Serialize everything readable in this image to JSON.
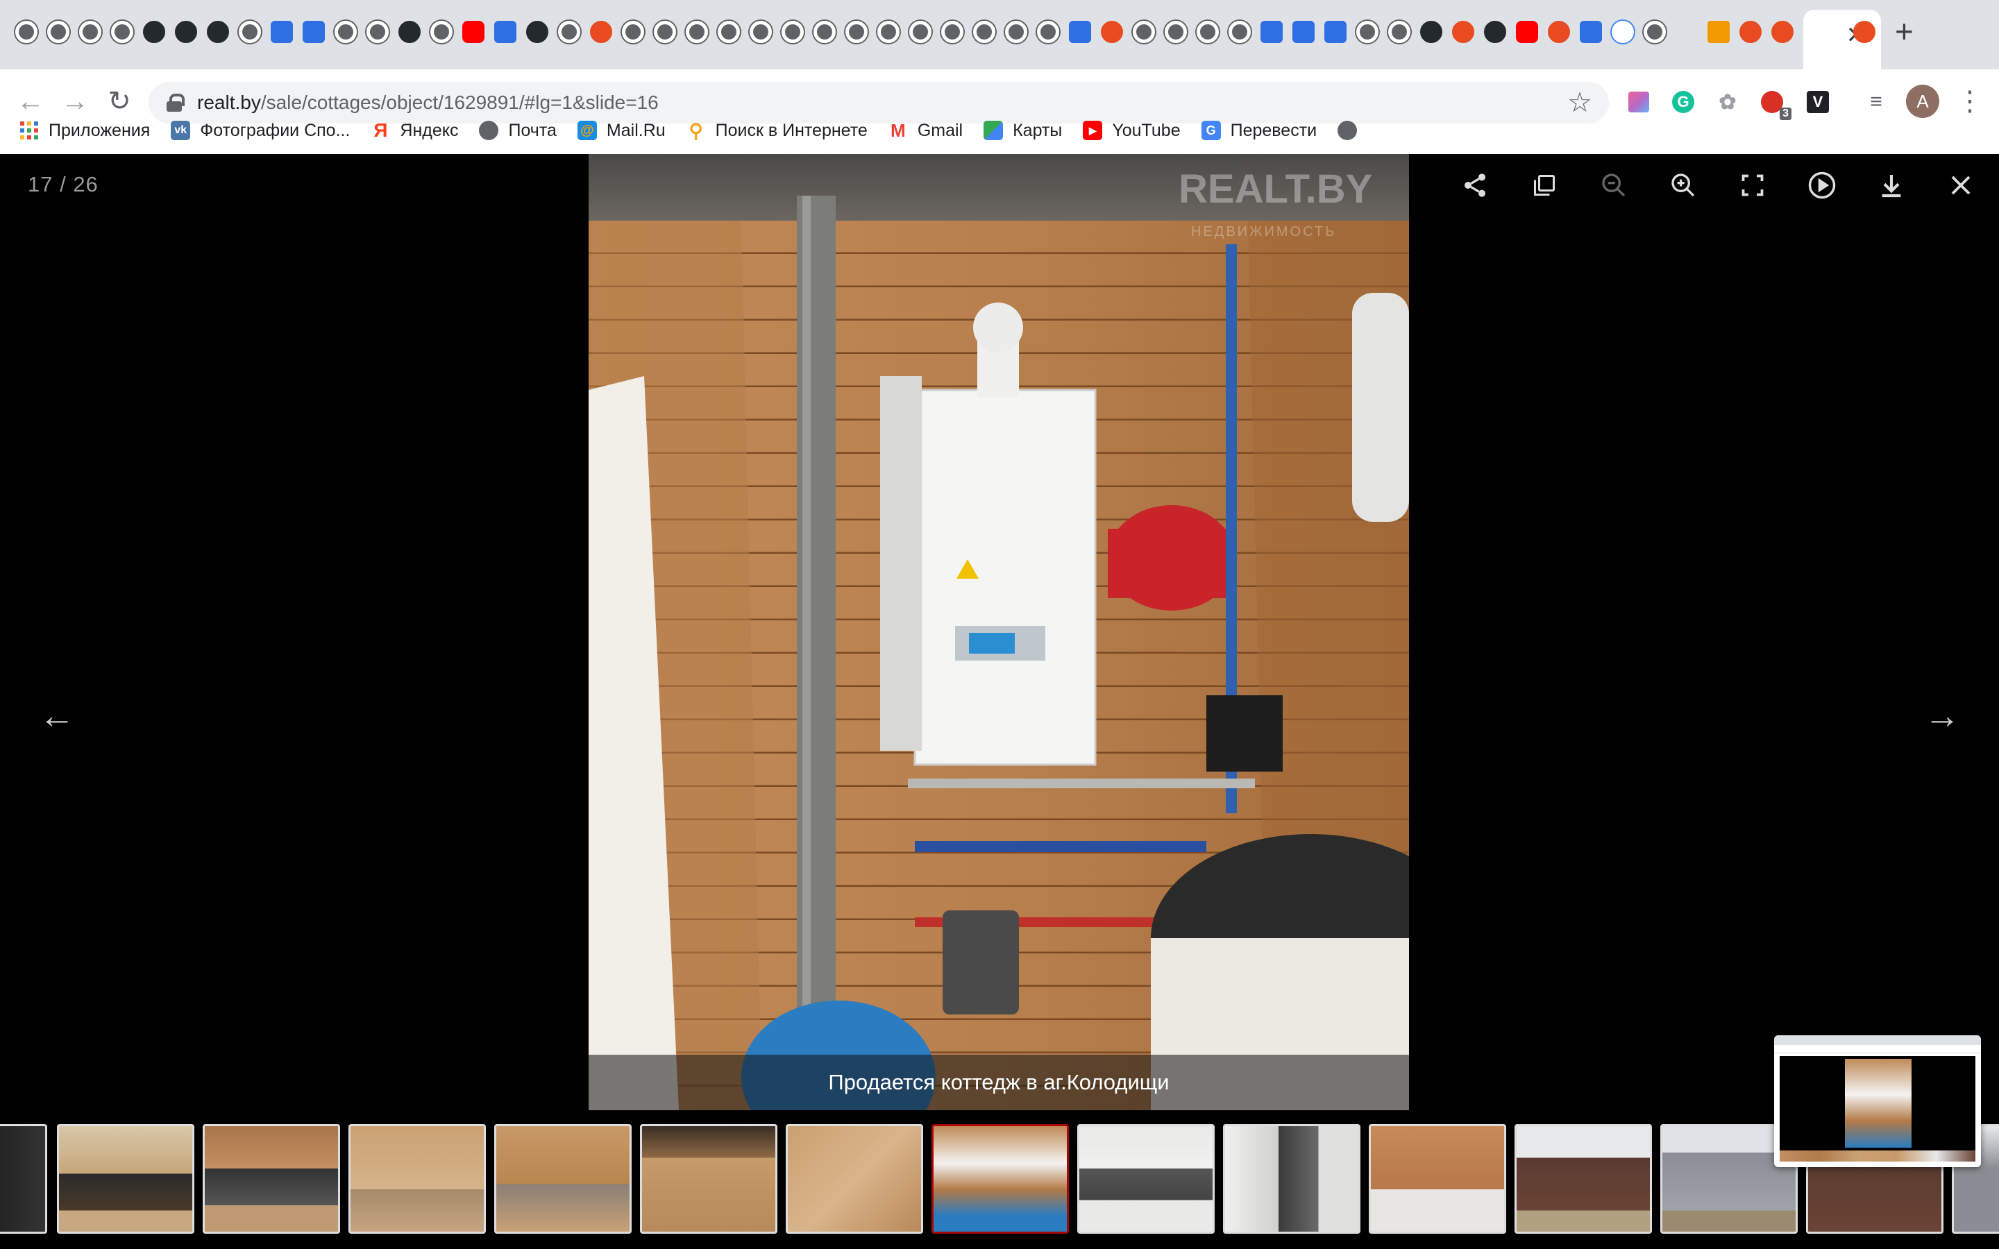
{
  "browser": {
    "active_tab_close": "✕",
    "new_tab": "+",
    "url_host": "realt.by",
    "url_path": "/sale/cottages/object/1629891/#lg=1&slide=16",
    "profile_initial": "A",
    "extension_badge": "3",
    "bookmarks": [
      {
        "label": "Приложения",
        "icon": "apps-grid-icon"
      },
      {
        "label": "Фотографии Спо...",
        "icon": "vk-icon"
      },
      {
        "label": "Яндекс",
        "icon": "yandex-icon"
      },
      {
        "label": "Почта",
        "icon": "globe-icon"
      },
      {
        "label": "Mail.Ru",
        "icon": "mailru-icon"
      },
      {
        "label": "Поиск в Интернете",
        "icon": "search-icon"
      },
      {
        "label": "Gmail",
        "icon": "gmail-icon"
      },
      {
        "label": "Карты",
        "icon": "maps-icon"
      },
      {
        "label": "YouTube",
        "icon": "youtube-icon"
      },
      {
        "label": "Перевести",
        "icon": "translate-icon"
      }
    ]
  },
  "lightbox": {
    "counter": "17 / 26",
    "caption": "Продается коттедж в аг.Колодищи",
    "watermark_main": "REALT.BY",
    "watermark_sub": "НЕДВИЖИМОСТЬ",
    "toolbar": [
      "share-icon",
      "copy-icon",
      "zoom-out-icon",
      "zoom-in-icon",
      "fullscreen-icon",
      "play-icon",
      "download-icon",
      "close-icon"
    ],
    "prev_arrow": "←",
    "next_arrow": "→"
  },
  "colors": {
    "active_thumb_border": "#a90707",
    "lightbox_bg": "#000000",
    "tabstrip_bg": "#dee1e6"
  }
}
